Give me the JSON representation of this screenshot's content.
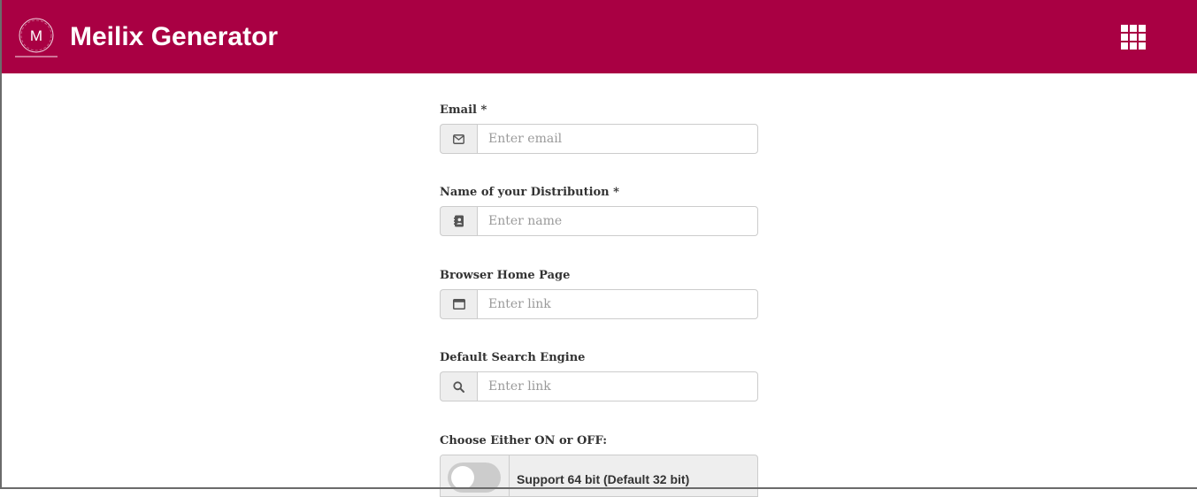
{
  "header": {
    "logo_letter": "M",
    "title": "Meilix Generator",
    "apps_icon": "apps-grid-icon",
    "background_color": "#a90043"
  },
  "form": {
    "email": {
      "label": "Email *",
      "placeholder": "Enter email",
      "value": "",
      "icon": "envelope-icon"
    },
    "distro_name": {
      "label": "Name of your Distribution *",
      "placeholder": "Enter name",
      "value": "",
      "icon": "address-book-icon"
    },
    "home_page": {
      "label": "Browser Home Page",
      "placeholder": "Enter link",
      "value": "",
      "icon": "browser-window-icon"
    },
    "search_engine": {
      "label": "Default Search Engine",
      "placeholder": "Enter link",
      "value": "",
      "icon": "search-icon"
    },
    "arch_toggle": {
      "heading": "Choose Either ON or OFF:",
      "label": "Support 64 bit (Default 32 bit)",
      "state": "off"
    }
  }
}
